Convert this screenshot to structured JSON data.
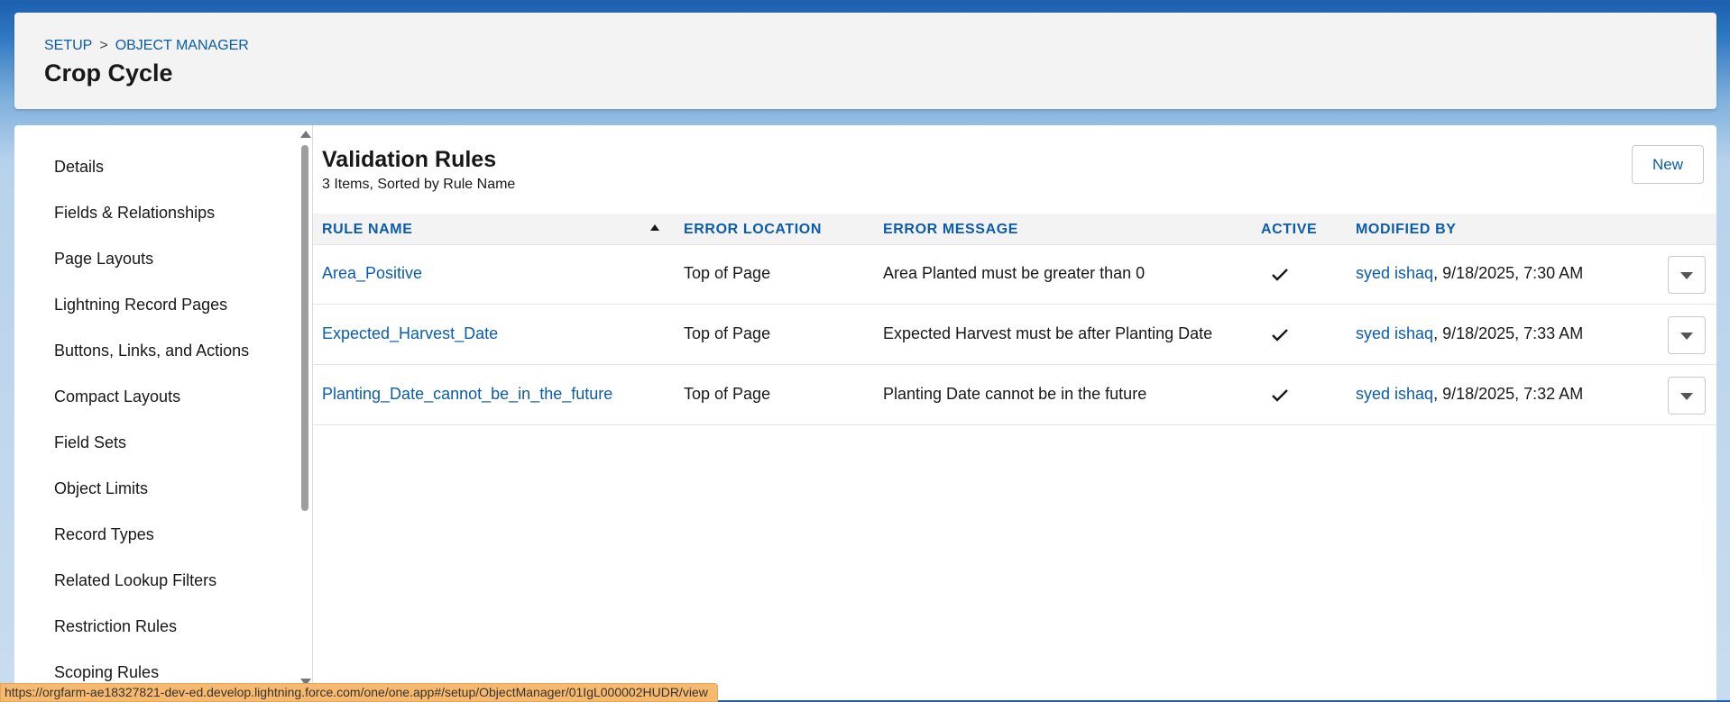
{
  "breadcrumb": {
    "setup": "SETUP",
    "separator": ">",
    "object_manager": "OBJECT MANAGER"
  },
  "page_title": "Crop Cycle",
  "sidebar": {
    "items": [
      {
        "label": "Details"
      },
      {
        "label": "Fields & Relationships"
      },
      {
        "label": "Page Layouts"
      },
      {
        "label": "Lightning Record Pages"
      },
      {
        "label": "Buttons, Links, and Actions"
      },
      {
        "label": "Compact Layouts"
      },
      {
        "label": "Field Sets"
      },
      {
        "label": "Object Limits"
      },
      {
        "label": "Record Types"
      },
      {
        "label": "Related Lookup Filters"
      },
      {
        "label": "Restriction Rules"
      },
      {
        "label": "Scoping Rules"
      }
    ]
  },
  "list": {
    "title": "Validation Rules",
    "subtitle": "3 Items, Sorted by Rule Name",
    "new_button": "New",
    "columns": [
      "Rule Name",
      "Error Location",
      "Error Message",
      "Active",
      "Modified By"
    ],
    "rows": [
      {
        "rule_name": "Area_Positive",
        "error_location": "Top of Page",
        "error_message": "Area Planted must be greater than 0",
        "active": true,
        "modified_by": "syed ishaq",
        "modified_date": ", 9/18/2025, 7:30 AM"
      },
      {
        "rule_name": "Expected_Harvest_Date",
        "error_location": "Top of Page",
        "error_message": "Expected Harvest must be after Planting Date",
        "active": true,
        "modified_by": "syed ishaq",
        "modified_date": ", 9/18/2025, 7:33 AM"
      },
      {
        "rule_name": "Planting_Date_cannot_be_in_the_future",
        "error_location": "Top of Page",
        "error_message": "Planting Date cannot be in the future",
        "active": true,
        "modified_by": "syed ishaq",
        "modified_date": ", 9/18/2025, 7:32 AM"
      }
    ]
  },
  "status_url": "https://orgfarm-ae18327821-dev-ed.develop.lightning.force.com/one/one.app#/setup/ObjectManager/01IgL000002HUDR/view",
  "icons": {
    "sort": "sort-ascending-icon",
    "check": "check-icon",
    "row_menu": "chevron-down-icon"
  },
  "colors": {
    "link": "#0b5cab",
    "header_bg": "#f3f3f3",
    "status_bg": "#f7b96d"
  }
}
